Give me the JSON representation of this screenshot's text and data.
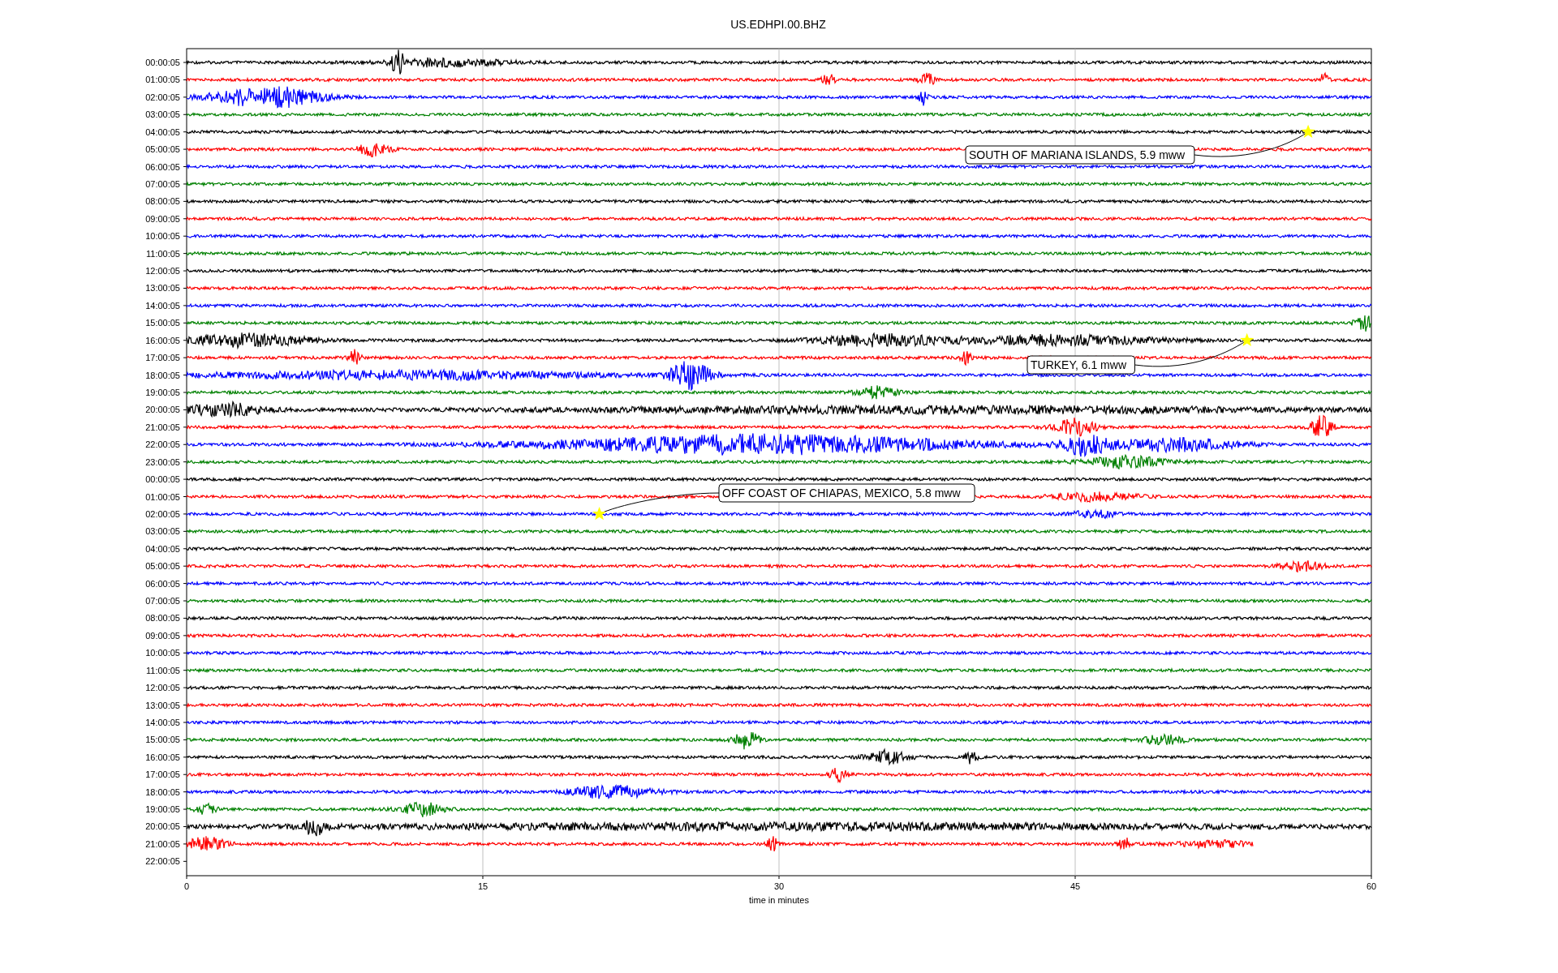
{
  "title": "US.EDHPI.00.BHZ",
  "rows": [
    {
      "label": "00:00:05",
      "color": "#000000"
    },
    {
      "label": "01:00:05",
      "color": "#ff0000"
    },
    {
      "label": "02:00:05",
      "color": "#0000ff"
    },
    {
      "label": "03:00:05",
      "color": "#008000"
    },
    {
      "label": "04:00:05",
      "color": "#000000"
    },
    {
      "label": "05:00:05",
      "color": "#ff0000"
    },
    {
      "label": "06:00:05",
      "color": "#0000ff"
    },
    {
      "label": "07:00:05",
      "color": "#008000"
    },
    {
      "label": "08:00:05",
      "color": "#000000"
    },
    {
      "label": "09:00:05",
      "color": "#ff0000"
    },
    {
      "label": "10:00:05",
      "color": "#0000ff"
    },
    {
      "label": "11:00:05",
      "color": "#008000"
    },
    {
      "label": "12:00:05",
      "color": "#000000"
    },
    {
      "label": "13:00:05",
      "color": "#ff0000"
    },
    {
      "label": "14:00:05",
      "color": "#0000ff"
    },
    {
      "label": "15:00:05",
      "color": "#008000"
    },
    {
      "label": "16:00:05",
      "color": "#000000"
    },
    {
      "label": "17:00:05",
      "color": "#ff0000"
    },
    {
      "label": "18:00:05",
      "color": "#0000ff"
    },
    {
      "label": "19:00:05",
      "color": "#008000"
    },
    {
      "label": "20:00:05",
      "color": "#000000"
    },
    {
      "label": "21:00:05",
      "color": "#ff0000"
    },
    {
      "label": "22:00:05",
      "color": "#0000ff"
    },
    {
      "label": "23:00:05",
      "color": "#008000"
    },
    {
      "label": "00:00:05",
      "color": "#000000"
    },
    {
      "label": "01:00:05",
      "color": "#ff0000"
    },
    {
      "label": "02:00:05",
      "color": "#0000ff"
    },
    {
      "label": "03:00:05",
      "color": "#008000"
    },
    {
      "label": "04:00:05",
      "color": "#000000"
    },
    {
      "label": "05:00:05",
      "color": "#ff0000"
    },
    {
      "label": "06:00:05",
      "color": "#0000ff"
    },
    {
      "label": "07:00:05",
      "color": "#008000"
    },
    {
      "label": "08:00:05",
      "color": "#000000"
    },
    {
      "label": "09:00:05",
      "color": "#ff0000"
    },
    {
      "label": "10:00:05",
      "color": "#0000ff"
    },
    {
      "label": "11:00:05",
      "color": "#008000"
    },
    {
      "label": "12:00:05",
      "color": "#000000"
    },
    {
      "label": "13:00:05",
      "color": "#ff0000"
    },
    {
      "label": "14:00:05",
      "color": "#0000ff"
    },
    {
      "label": "15:00:05",
      "color": "#008000"
    },
    {
      "label": "16:00:05",
      "color": "#000000"
    },
    {
      "label": "17:00:05",
      "color": "#ff0000"
    },
    {
      "label": "18:00:05",
      "color": "#0000ff"
    },
    {
      "label": "19:00:05",
      "color": "#008000"
    },
    {
      "label": "20:00:05",
      "color": "#000000"
    },
    {
      "label": "21:00:05",
      "color": "#ff0000"
    },
    {
      "label": "22:00:05"
    }
  ],
  "xaxis": {
    "label": "time in minutes",
    "ticks": [
      "0",
      "15",
      "30",
      "45",
      "60"
    ]
  },
  "events": [
    {
      "text": "SOUTH OF MARIANA ISLANDS, 5.9 mww"
    },
    {
      "text": "TURKEY, 6.1 mww"
    },
    {
      "text": "OFF COAST OF CHIAPAS, MEXICO, 5.8 mww"
    }
  ]
}
